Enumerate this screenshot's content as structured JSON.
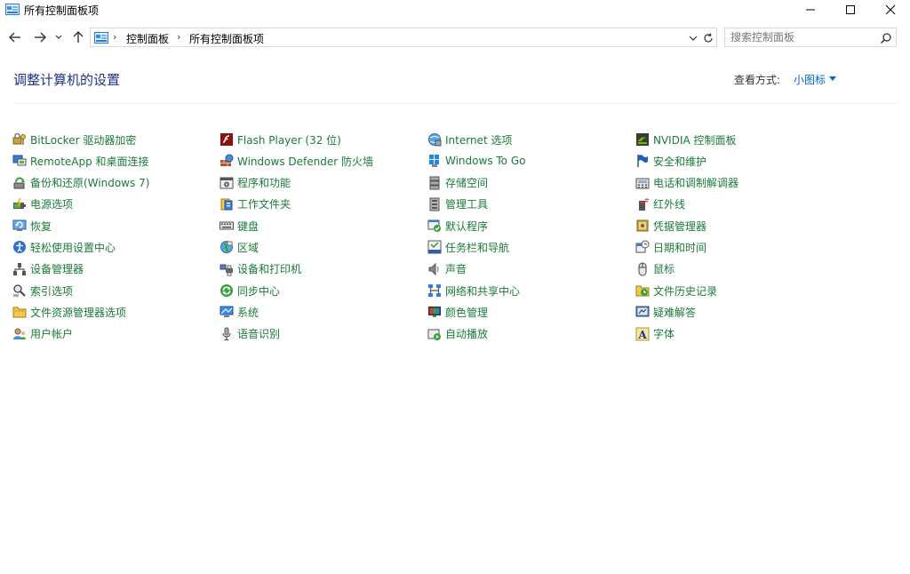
{
  "window": {
    "title": "所有控制面板项"
  },
  "address": {
    "crumbs": [
      "控制面板",
      "所有控制面板项"
    ],
    "search_placeholder": "搜索控制面板"
  },
  "header": {
    "title": "调整计算机的设置",
    "view_by_label": "查看方式:",
    "view_by_value": "小图标"
  },
  "colors": {
    "link": "#1a7a3a",
    "heading": "#1e3287",
    "accent": "#0066cc"
  },
  "items": [
    {
      "label": "BitLocker 驱动器加密",
      "icon": "bitlocker-icon"
    },
    {
      "label": "Flash Player (32 位)",
      "icon": "flash-icon"
    },
    {
      "label": "Internet 选项",
      "icon": "internet-options-icon"
    },
    {
      "label": "NVIDIA 控制面板",
      "icon": "nvidia-icon"
    },
    {
      "label": "RemoteApp 和桌面连接",
      "icon": "remoteapp-icon"
    },
    {
      "label": "Windows Defender 防火墙",
      "icon": "firewall-icon"
    },
    {
      "label": "Windows To Go",
      "icon": "windows-to-go-icon"
    },
    {
      "label": "安全和维护",
      "icon": "flag-icon"
    },
    {
      "label": "备份和还原(Windows 7)",
      "icon": "backup-icon"
    },
    {
      "label": "程序和功能",
      "icon": "programs-icon"
    },
    {
      "label": "存储空间",
      "icon": "storage-icon"
    },
    {
      "label": "电话和调制解调器",
      "icon": "phone-modem-icon"
    },
    {
      "label": "电源选项",
      "icon": "power-icon"
    },
    {
      "label": "工作文件夹",
      "icon": "work-folders-icon"
    },
    {
      "label": "管理工具",
      "icon": "admin-tools-icon"
    },
    {
      "label": "红外线",
      "icon": "infrared-icon"
    },
    {
      "label": "恢复",
      "icon": "recovery-icon"
    },
    {
      "label": "键盘",
      "icon": "keyboard-icon"
    },
    {
      "label": "默认程序",
      "icon": "default-programs-icon"
    },
    {
      "label": "凭据管理器",
      "icon": "credential-icon"
    },
    {
      "label": "轻松使用设置中心",
      "icon": "ease-of-access-icon"
    },
    {
      "label": "区域",
      "icon": "region-icon"
    },
    {
      "label": "任务栏和导航",
      "icon": "taskbar-icon"
    },
    {
      "label": "日期和时间",
      "icon": "date-time-icon"
    },
    {
      "label": "设备管理器",
      "icon": "device-manager-icon"
    },
    {
      "label": "设备和打印机",
      "icon": "printer-icon"
    },
    {
      "label": "声音",
      "icon": "sound-icon"
    },
    {
      "label": "鼠标",
      "icon": "mouse-icon"
    },
    {
      "label": "索引选项",
      "icon": "indexing-icon"
    },
    {
      "label": "同步中心",
      "icon": "sync-icon"
    },
    {
      "label": "网络和共享中心",
      "icon": "network-icon"
    },
    {
      "label": "文件历史记录",
      "icon": "file-history-icon"
    },
    {
      "label": "文件资源管理器选项",
      "icon": "folder-options-icon"
    },
    {
      "label": "系统",
      "icon": "system-icon"
    },
    {
      "label": "颜色管理",
      "icon": "color-management-icon"
    },
    {
      "label": "疑难解答",
      "icon": "troubleshoot-icon"
    },
    {
      "label": "用户帐户",
      "icon": "user-accounts-icon"
    },
    {
      "label": "语音识别",
      "icon": "microphone-icon"
    },
    {
      "label": "自动播放",
      "icon": "autoplay-icon"
    },
    {
      "label": "字体",
      "icon": "fonts-icon"
    }
  ]
}
